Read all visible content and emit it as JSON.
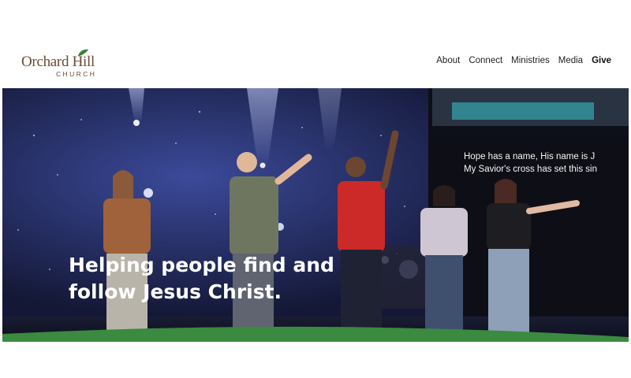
{
  "logo": {
    "name": "Orchard Hill",
    "sub": "CHURCH"
  },
  "nav": {
    "about": "About",
    "connect": "Connect",
    "ministries": "Ministries",
    "media": "Media",
    "give": "Give"
  },
  "hero": {
    "headline_line1": "Helping people find and",
    "headline_line2": "follow Jesus Christ.",
    "lyric_line1": "Hope has a name, His name is J",
    "lyric_line2": "My Savior's cross has set this sin"
  },
  "colors": {
    "accent_green": "#3a8a3f",
    "brand_brown": "#6d4a35",
    "stage_blue": "#1b1f4a"
  }
}
